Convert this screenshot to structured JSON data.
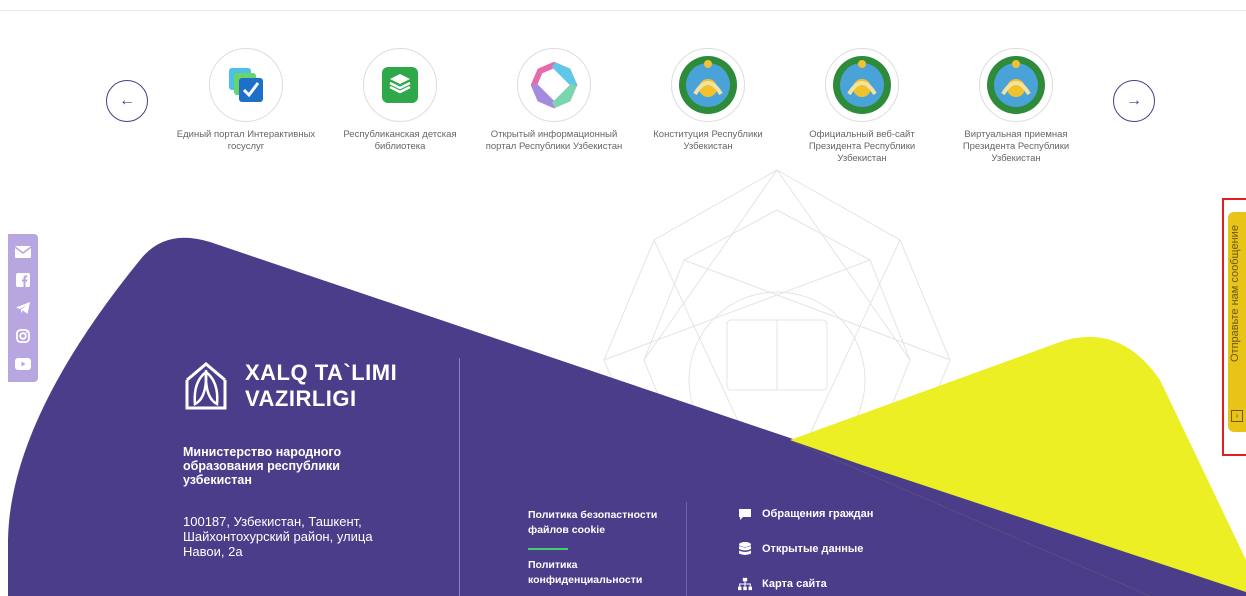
{
  "carousel": {
    "prev_icon": "arrow-left-icon",
    "next_icon": "arrow-right-icon",
    "items": [
      {
        "label": "Единый портал Интерактивных госуслуг",
        "icon": "gov-services-checkbox-icon"
      },
      {
        "label": "Республиканская детская библиотека",
        "icon": "library-books-icon"
      },
      {
        "label": "Открытый информационный портал Республики Узбекистан",
        "icon": "open-data-ring-icon"
      },
      {
        "label": "Конституция Республики Узбекистан",
        "icon": "uzbekistan-emblem-icon"
      },
      {
        "label": "Официальный веб-сайт Президента Республики Узбекистан",
        "icon": "uzbekistan-emblem-icon"
      },
      {
        "label": "Виртуальная приемная Президента Республики Узбекистан",
        "icon": "uzbekistan-emblem-icon"
      }
    ]
  },
  "social": [
    "email-icon",
    "facebook-icon",
    "telegram-icon",
    "instagram-icon",
    "youtube-icon"
  ],
  "footer": {
    "brand_line1": "XALQ TA`LIMI",
    "brand_line2": "VAZIRLIGI",
    "ministry": "Министерство народного образования республики узбекистан",
    "address": "100187, Узбекистан, Ташкент, Шайхонтохурский район, улица Навои, 2а",
    "policies": [
      "Политика безопастности файлов cookie",
      "Политика конфиденциальности"
    ],
    "links": [
      {
        "label": "Обращения граждан",
        "icon": "chat-icon"
      },
      {
        "label": "Открытые данные",
        "icon": "database-icon"
      },
      {
        "label": "Карта сайта",
        "icon": "sitemap-icon"
      }
    ]
  },
  "feedback": {
    "label": "Отправьте нам сообщение",
    "icon": "message-icon"
  },
  "colors": {
    "purple": "#4b3d8a",
    "yellow": "#ecef24",
    "social_bg": "#b7a6e0",
    "highlight": "#e02020"
  }
}
